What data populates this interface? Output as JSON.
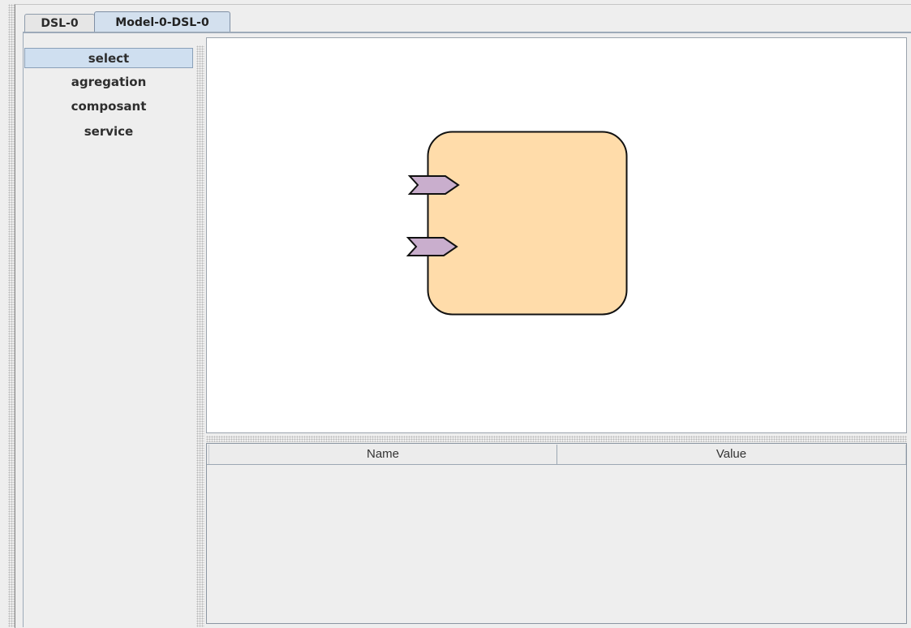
{
  "tabs": [
    {
      "label": "DSL-0",
      "active": false
    },
    {
      "label": "Model-0-DSL-0",
      "active": true
    }
  ],
  "palette": {
    "items": [
      "select",
      "agregation",
      "composant",
      "service"
    ],
    "selected": "select"
  },
  "diagram": {
    "component_fill": "#ffdcaa",
    "port_fill": "#c9aecd"
  },
  "properties": {
    "columns": [
      "Name",
      "Value"
    ]
  }
}
